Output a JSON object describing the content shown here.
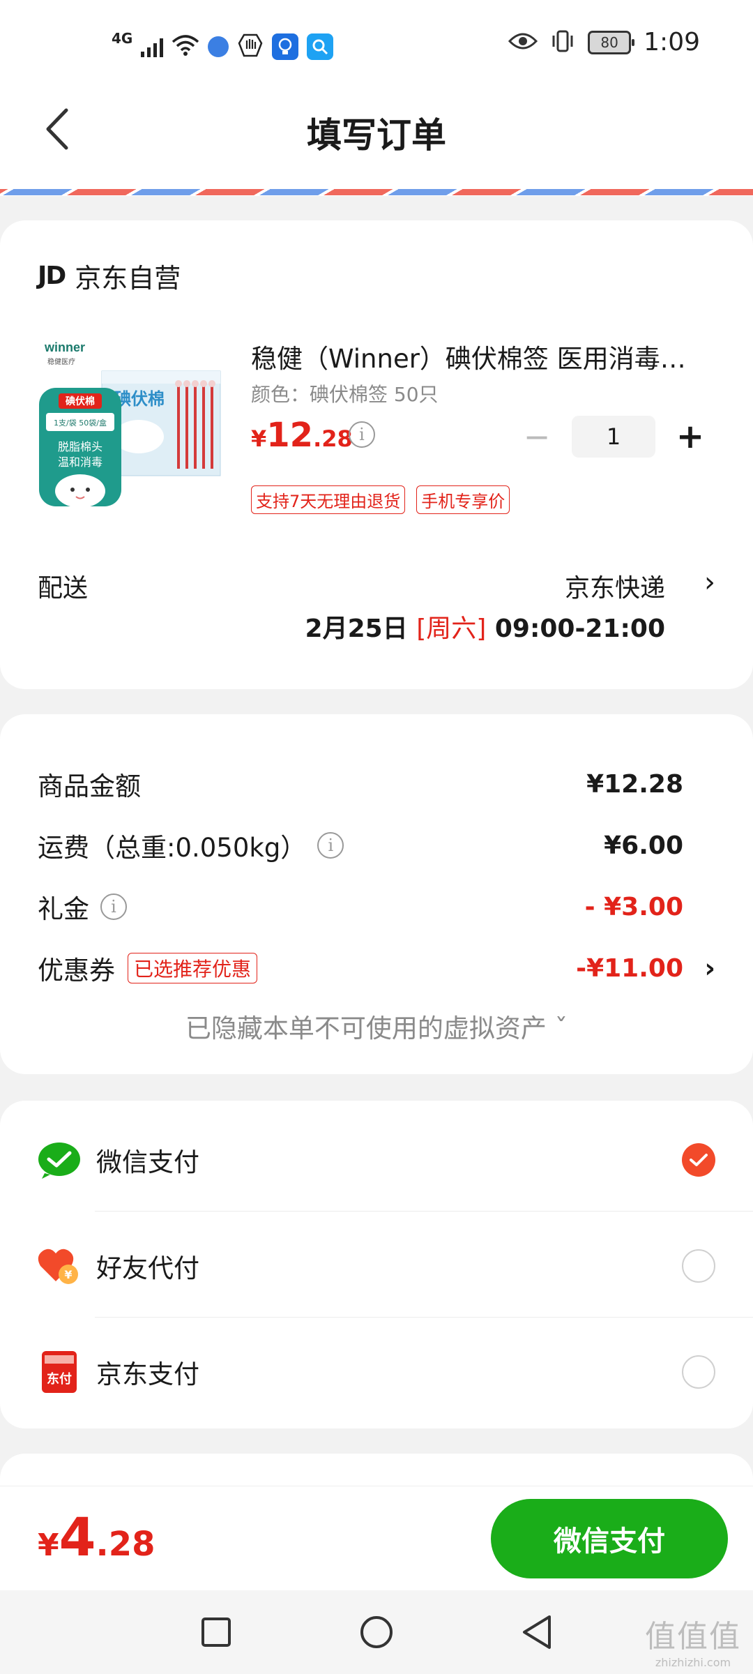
{
  "status_bar": {
    "network": "4G",
    "battery": "80",
    "time": "1:09"
  },
  "header": {
    "title": "填写订单"
  },
  "shop": {
    "logo": "JD",
    "name": "京东自营"
  },
  "product": {
    "image_text": {
      "brand": "winner",
      "brand_cn": "稳健医疗",
      "box_label": "碘伏棉",
      "pouch_badge": "碘伏棉",
      "pouch_spec": "1支/袋 50袋/盒",
      "pouch_line1": "脱脂棉头",
      "pouch_line2": "温和消毒"
    },
    "title": "稳健（Winner）碘伏棉签 医用消毒棉棒",
    "spec": "颜色：碘伏棉签 50只",
    "price_currency": "¥",
    "price_int": "12",
    "price_dec": ".28",
    "quantity": "1",
    "tags": [
      "支持7天无理由退货",
      "手机专享价"
    ]
  },
  "shipping": {
    "label": "配送",
    "carrier": "京东快递",
    "date": "2月25日 ",
    "weekday": "[周六]",
    "time_range": " 09:00-21:00"
  },
  "price_detail": {
    "goods_label": "商品金额",
    "goods_value": "¥12.28",
    "freight_label": "运费（总重:0.050kg）",
    "freight_value": "¥6.00",
    "gift_label": "礼金",
    "gift_value": "- ¥3.00",
    "coupon_label": "优惠券",
    "coupon_tag": "已选推荐优惠",
    "coupon_value": "-¥11.00",
    "hidden_assets": "已隐藏本单不可使用的虚拟资产 ˇ"
  },
  "payment_methods": [
    {
      "label": "微信支付",
      "selected": true,
      "icon": "wechat-pay-icon"
    },
    {
      "label": "好友代付",
      "selected": false,
      "icon": "friend-pay-icon"
    },
    {
      "label": "京东支付",
      "selected": false,
      "icon": "jd-pay-icon"
    }
  ],
  "jd_pay_icon_text": "东付",
  "friend_pay_icon_text": "¥",
  "footer": {
    "total_currency": "¥",
    "total_int": "4",
    "total_dec": ".28",
    "pay_button": "微信支付"
  },
  "watermark": {
    "mark": "值值值",
    "url": "zhizhizhi.com"
  },
  "colors": {
    "accent_red": "#e2231a",
    "wechat_green": "#1aad19",
    "radio_selected": "#f24a2a"
  }
}
